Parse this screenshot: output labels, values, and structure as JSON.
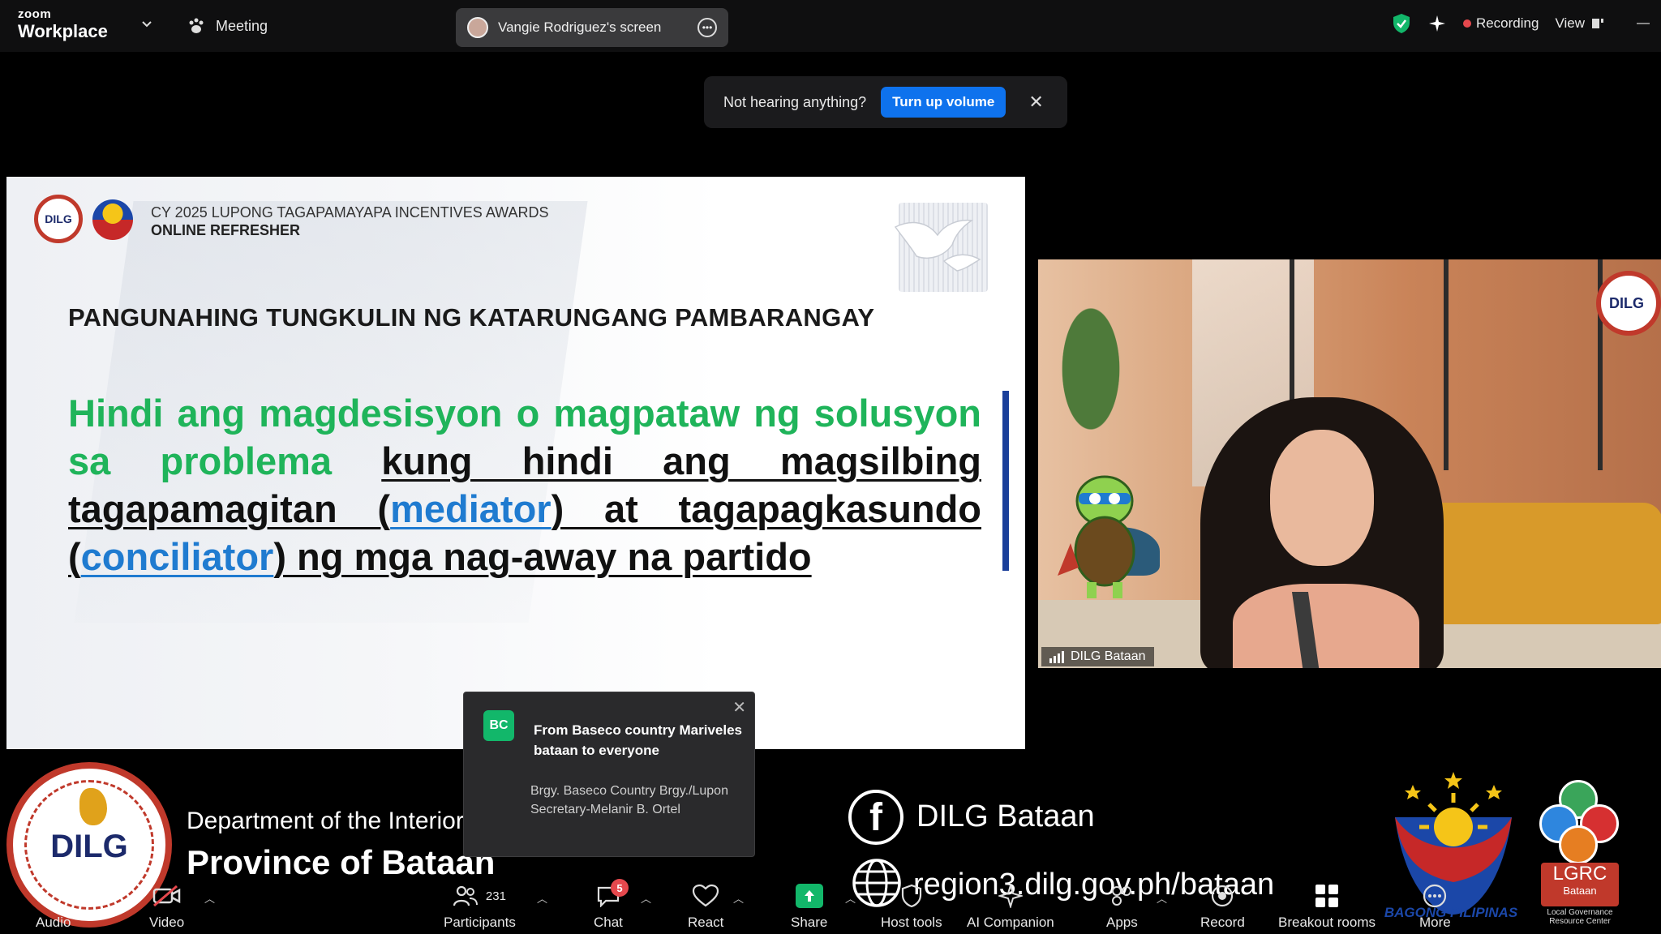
{
  "app": {
    "brand_top": "zoom",
    "brand_bottom": "Workplace",
    "meeting_label": "Meeting",
    "share_label": "Vangie Rodriguez's screen",
    "recording_label": "Recording",
    "view_label": "View"
  },
  "banner": {
    "text": "Not hearing anything?",
    "button": "Turn up volume",
    "close": "✕"
  },
  "slide": {
    "logo_text": "DILG",
    "title_line1": "CY 2025 LUPONG TAGAPAMAYAPA INCENTIVES AWARDS",
    "title_line2": "ONLINE REFRESHER",
    "heading": "PANGUNAHING TUNGKULIN NG KATARUNGANG PAMBARANGAY",
    "body_green": "Hindi ang magdesisyon o magpataw ng solusyon sa problema",
    "body_u1": "kung hindi ang magsilbing tagapamagitan (",
    "body_blue1": "mediator",
    "body_u2": ") at tagapagkasundo (",
    "body_blue2": "conciliator",
    "body_u3": ") ng mga nag-away na partido"
  },
  "camera": {
    "participant_name": "DILG Bataan",
    "badge_text": "DILG"
  },
  "chat_popup": {
    "avatar": "BC",
    "from": "From Baseco country Mariveles bataan to everyone",
    "message": "Brgy. Baseco Country Brgy./Lupon Secretary-Melanir B. Ortel"
  },
  "overlay": {
    "seal_text": "DILG",
    "department": "Department of the Interior and Local Government",
    "province": "Province of Bataan",
    "facebook": "DILG Bataan",
    "website": "region3.dilg.gov.ph/bataan",
    "bp_label": "BAGONG PILIPINAS",
    "lgrc_title": "LGRC",
    "lgrc_sub": "Bataan",
    "lgrc_caption": "Local Governance Resource Center"
  },
  "toolbar": {
    "audio": "Audio",
    "video": "Video",
    "participants": "Participants",
    "participants_count": "231",
    "chat": "Chat",
    "chat_badge": "5",
    "react": "React",
    "share": "Share",
    "host_tools": "Host tools",
    "ai_companion": "AI Companion",
    "apps": "Apps",
    "record": "Record",
    "breakout_rooms": "Breakout rooms",
    "more": "More"
  },
  "colors": {
    "accent_blue": "#0e72ed",
    "recording_red": "#e5484d",
    "slide_green": "#1fb45a",
    "slide_blue": "#1f7bd0",
    "share_green": "#12b76a"
  }
}
